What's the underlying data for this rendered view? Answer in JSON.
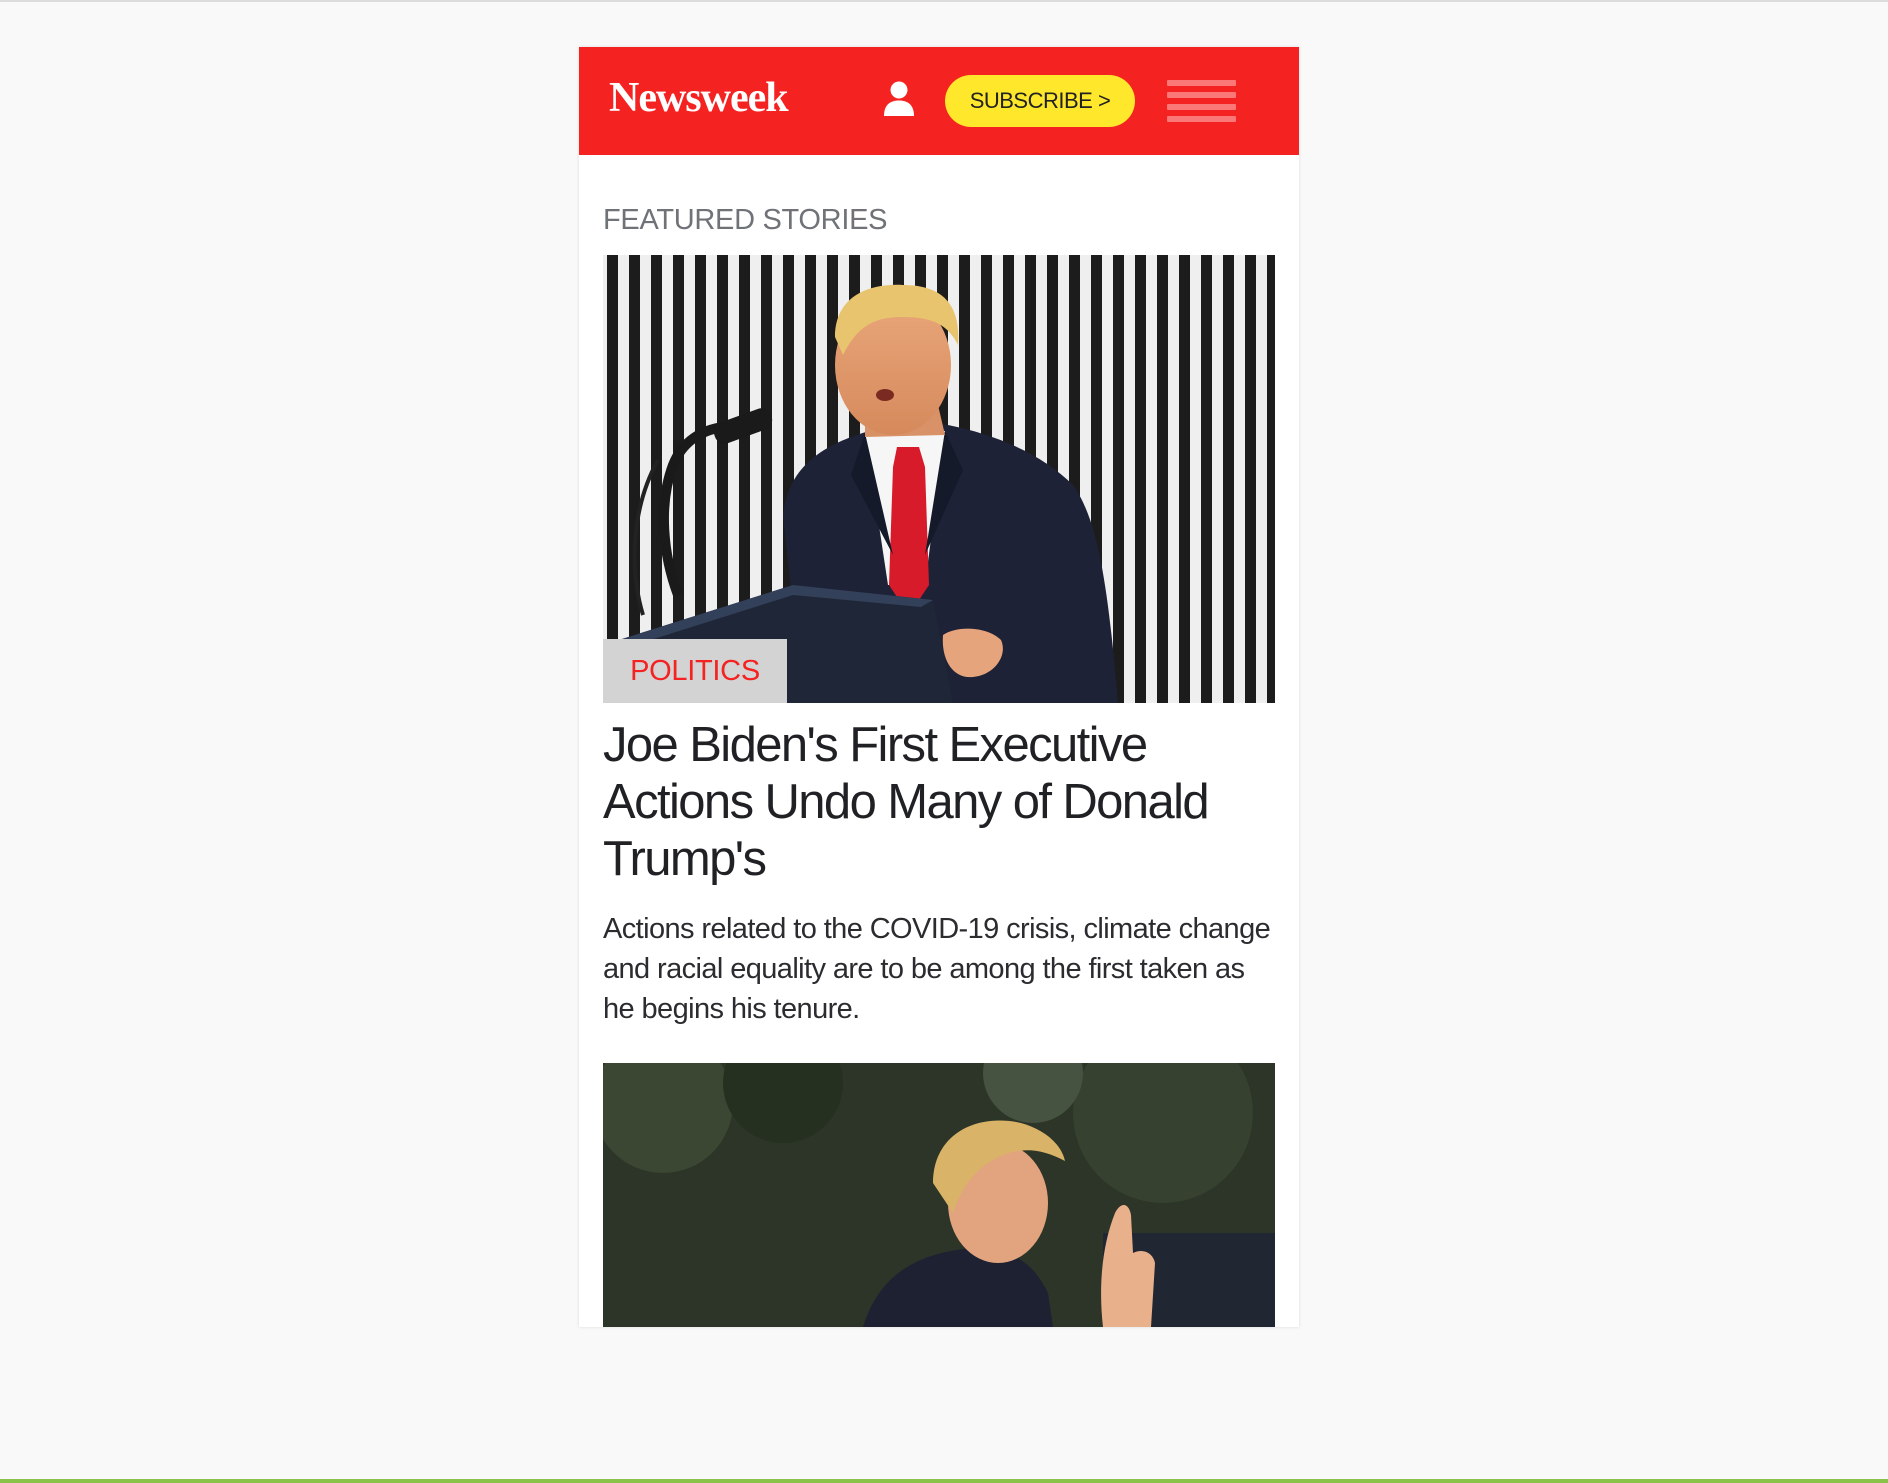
{
  "header": {
    "logo_text": "Newsweek",
    "subscribe_label": "SUBSCRIBE >",
    "user_icon": "user-icon",
    "menu_icon": "hamburger-menu-icon",
    "brand_color": "#f52222",
    "subscribe_color": "#ffe82c"
  },
  "main": {
    "section_title": "FEATURED STORIES",
    "featured": [
      {
        "category": "POLITICS",
        "headline": "Joe Biden's First Executive Actions Undo Many of Donald Trump's",
        "summary": "Actions related to the COVID-19 crisis, climate change and racial equality are to be among the first taken as he begins his tenure."
      }
    ]
  }
}
